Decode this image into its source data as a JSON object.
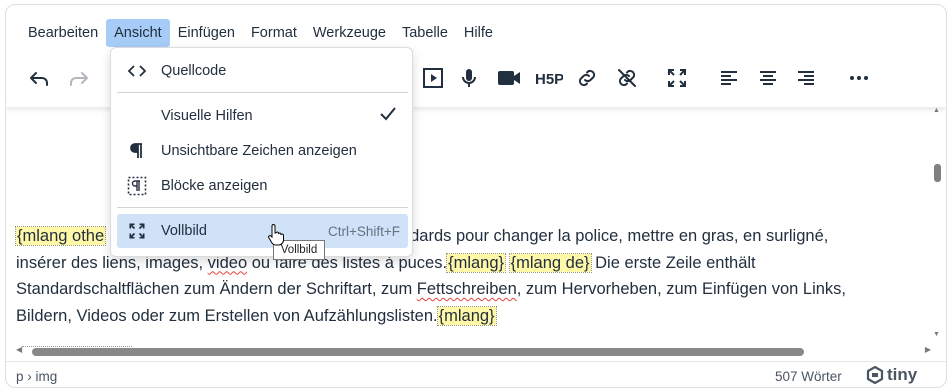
{
  "menubar": {
    "items": [
      "Bearbeiten",
      "Ansicht",
      "Einfügen",
      "Format",
      "Werkzeuge",
      "Tabelle",
      "Hilfe"
    ],
    "active": "Ansicht"
  },
  "toolbar": {
    "buttons": [
      "undo-icon",
      "redo-icon",
      "media-icon",
      "microphone-icon",
      "video-icon",
      "h5p-icon",
      "link-icon",
      "unlink-icon",
      "fullscreen-icon",
      "align-left-icon",
      "align-center-icon",
      "align-right-icon",
      "more-icon"
    ]
  },
  "dropdown": {
    "items": [
      {
        "label": "Quellcode",
        "icon": "source-code-icon"
      },
      {
        "label": "Visuelle Hilfen",
        "icon": "",
        "checked": true
      },
      {
        "label": "Unsichtbare Zeichen anzeigen",
        "icon": "pilcrow-icon"
      },
      {
        "label": "Blöcke anzeigen",
        "icon": "show-blocks-icon"
      },
      {
        "label": "Vollbild",
        "icon": "fullscreen-icon",
        "shortcut": "Ctrl+Shift+F",
        "highlighted": true
      }
    ],
    "tooltip": "Vollbild"
  },
  "content": {
    "line1_tag": "{mlang othe",
    "line1_rest": "tandards pour changer la police, mettre en gras, en surligné,",
    "line2_a": "insérer des liens, images, ",
    "line2_video": "video",
    "line2_b": " ou faire des listes à puces.",
    "tag_mlang": "{mlang}",
    "tag_mlang_de": "{mlang de}",
    "line2_c": " Die erste Zeile enthält",
    "line3_a": "Standardschaltflächen zum Ändern der Schriftart, zum ",
    "line3_fett": "Fettschreiben",
    "line3_b": ", zum Hervorheben, zum Einfügen von Links,",
    "line4": "Bildern, Videos oder zum Erstellen von Aufzählungslisten.",
    "tag_end": "{mlang}"
  },
  "statusbar": {
    "path": "p › img",
    "word_count": "507 Wörter",
    "brand": "tiny"
  },
  "colors": {
    "menu_active": "#a6ccf7",
    "item_highlight": "#cfe2f8",
    "mlang_bg": "#fff8a8",
    "text": "#222f3e"
  }
}
